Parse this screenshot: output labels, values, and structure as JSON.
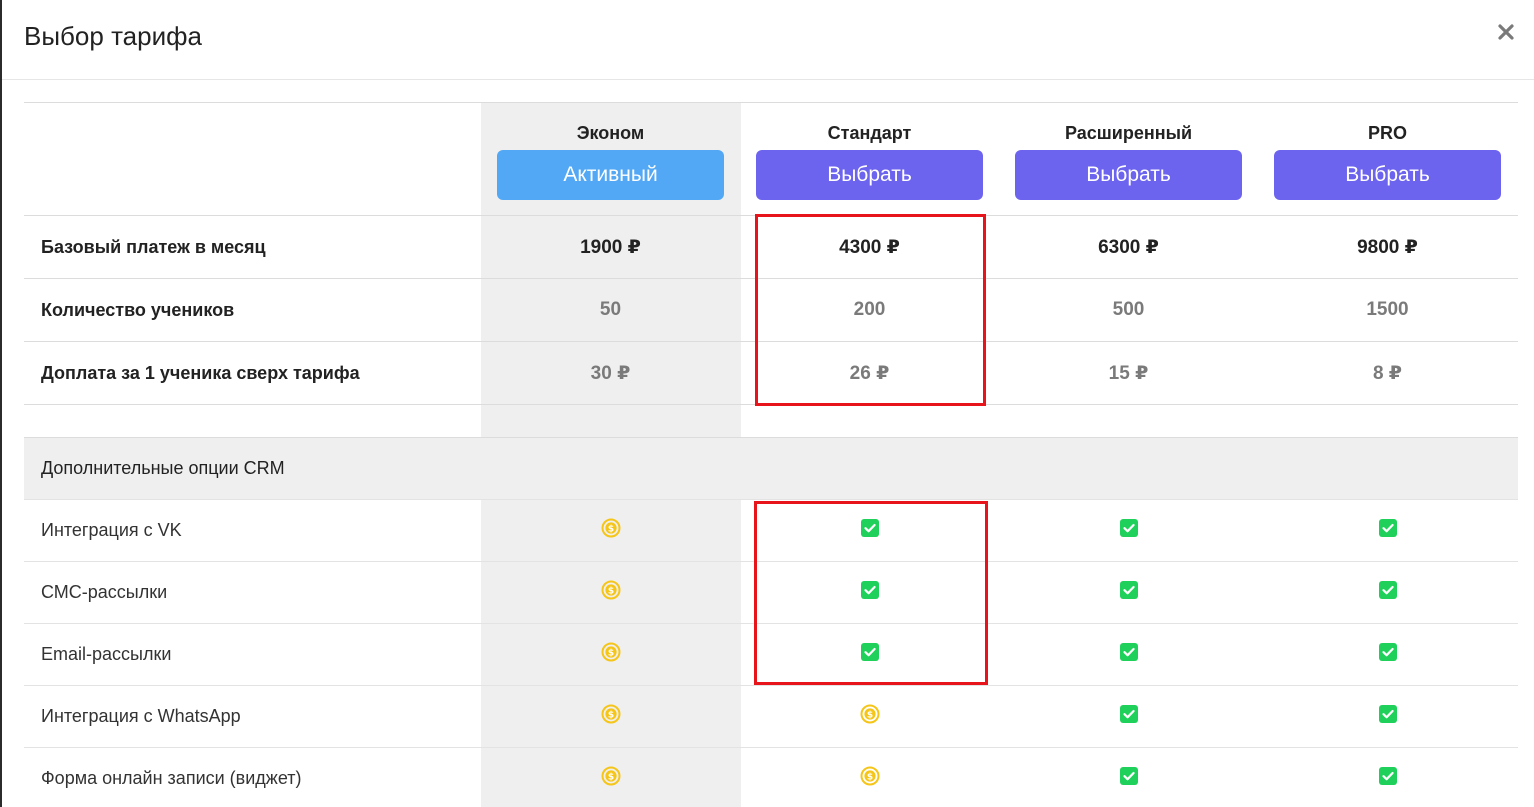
{
  "dialog": {
    "title": "Выбор тарифа",
    "close_label": "×"
  },
  "plans": [
    {
      "name": "Эконом",
      "button_label": "Активный",
      "button_state": "active"
    },
    {
      "name": "Стандарт",
      "button_label": "Выбрать",
      "button_state": "choose"
    },
    {
      "name": "Расширенный",
      "button_label": "Выбрать",
      "button_state": "choose"
    },
    {
      "name": "PRO",
      "button_label": "Выбрать",
      "button_state": "choose"
    }
  ],
  "pricing_rows": [
    {
      "label": "Базовый платеж в месяц",
      "values": [
        "1900 ₽",
        "4300 ₽",
        "6300 ₽",
        "9800 ₽"
      ]
    },
    {
      "label": "Количество учеников",
      "values": [
        "50",
        "200",
        "500",
        "1500"
      ]
    },
    {
      "label": "Доплата за 1 ученика сверх тарифа",
      "values": [
        "30 ₽",
        "26 ₽",
        "15 ₽",
        "8 ₽"
      ]
    }
  ],
  "options_section": {
    "title": "Дополнительные опции CRM",
    "rows": [
      {
        "label": "Интеграция с VK",
        "values": [
          "paid",
          "included",
          "included",
          "included"
        ]
      },
      {
        "label": "СМС-рассылки",
        "values": [
          "paid",
          "included",
          "included",
          "included"
        ]
      },
      {
        "label": "Email-рассылки",
        "values": [
          "paid",
          "included",
          "included",
          "included"
        ]
      },
      {
        "label": "Интеграция с WhatsApp",
        "values": [
          "paid",
          "paid",
          "included",
          "included"
        ]
      },
      {
        "label": "Форма онлайн записи (виджет)",
        "values": [
          "paid",
          "paid",
          "included",
          "included"
        ]
      }
    ]
  },
  "icons": {
    "paid": "coin-icon",
    "included": "check-icon"
  },
  "colors": {
    "active_button": "#52a8f5",
    "choose_button": "#6c63ef",
    "check": "#1fd15b",
    "coin": "#f5c518",
    "highlight": "#e8141b",
    "economy_band": "#efefef"
  }
}
